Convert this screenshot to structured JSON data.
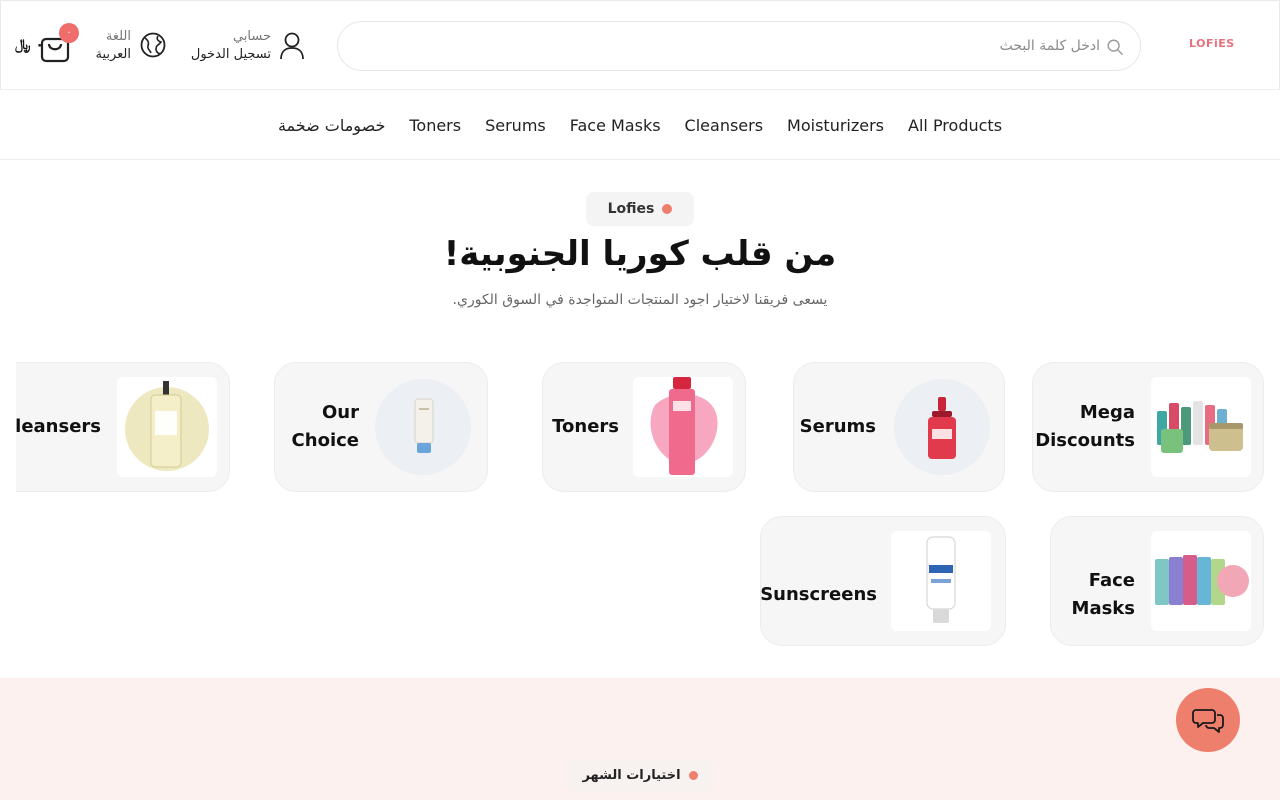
{
  "header": {
    "logo": "LOFiES",
    "search_placeholder": "ادخل كلمة البحث",
    "account": {
      "small": "حسابي",
      "big": "تسجيل الدخول"
    },
    "language": {
      "small": "اللغة",
      "big": "العربية"
    },
    "cart": {
      "count": "٠",
      "total": "٠ ﷼"
    }
  },
  "nav": {
    "items": [
      "All Products",
      "Moisturizers",
      "Cleansers",
      "Face Masks",
      "Serums",
      "Toners",
      "خصومات ضخمة"
    ]
  },
  "hero": {
    "badge": "Lofies",
    "title": "من قلب كوريا الجنوبية!",
    "subtitle": "يسعى فريقنا لاختيار اجود المنتجات المتواجدة في السوق الكوري."
  },
  "categories": [
    {
      "line1": "Mega",
      "line2": "Discounts",
      "image": "skincare-bundle-image"
    },
    {
      "line1": "Serums",
      "line2": "",
      "image": "serum-bottle-image"
    },
    {
      "line1": "Toners",
      "line2": "",
      "image": "toner-bottle-image"
    },
    {
      "line1": "Our",
      "line2": "Choice",
      "image": "cream-tube-image"
    },
    {
      "line1": "Cleansers",
      "line2": "",
      "image": "cleansing-oil-image"
    },
    {
      "line1": "Face",
      "line2": "Masks",
      "image": "sheet-masks-image"
    },
    {
      "line1": "Sunscreens",
      "line2": "",
      "image": "sunscreen-tube-image"
    }
  ],
  "section2": {
    "badge": "اختيارات الشهر"
  },
  "colors": {
    "accent": "#ef7f6d",
    "band": "#fcf1ee",
    "badge": "#ef6e6b"
  }
}
